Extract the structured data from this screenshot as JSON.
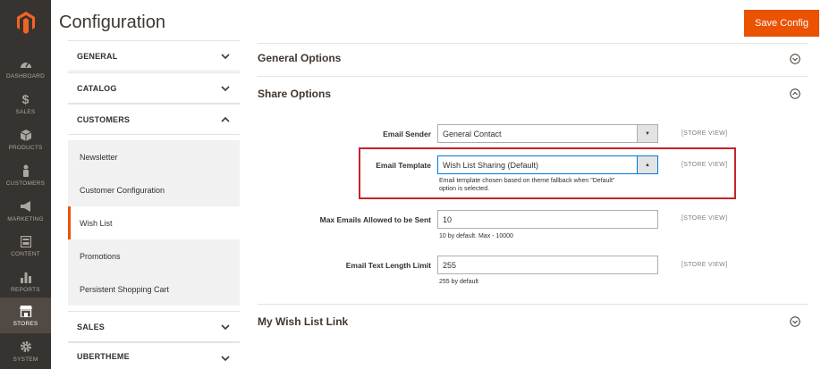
{
  "header": {
    "title": "Configuration",
    "save_label": "Save Config"
  },
  "admin_nav": [
    {
      "label": "DASHBOARD",
      "icon": "dashboard-icon"
    },
    {
      "label": "SALES",
      "icon": "dollar-icon"
    },
    {
      "label": "PRODUCTS",
      "icon": "cube-icon"
    },
    {
      "label": "CUSTOMERS",
      "icon": "person-icon"
    },
    {
      "label": "MARKETING",
      "icon": "megaphone-icon"
    },
    {
      "label": "CONTENT",
      "icon": "content-icon"
    },
    {
      "label": "REPORTS",
      "icon": "bar-chart-icon"
    },
    {
      "label": "STORES",
      "icon": "store-icon",
      "active": true
    },
    {
      "label": "SYSTEM",
      "icon": "gear-icon"
    }
  ],
  "tabs": {
    "general": "GENERAL",
    "catalog": "CATALOG",
    "customers": "CUSTOMERS",
    "items": [
      "Newsletter",
      "Customer Configuration",
      "Wish List",
      "Promotions",
      "Persistent Shopping Cart"
    ],
    "sales": "SALES",
    "ubertheme": "UBERTHEME"
  },
  "sections": {
    "general_options": "General Options",
    "share_options": "Share Options",
    "wish_list_link": "My Wish List Link"
  },
  "fields": {
    "email_sender": {
      "label": "Email Sender",
      "value": "General Contact",
      "scope": "[STORE VIEW]"
    },
    "email_template": {
      "label": "Email Template",
      "value": "Wish List Sharing (Default)",
      "note_line1": "Email template chosen based on theme fallback when \"Default\"",
      "note_line2": "option is selected.",
      "scope": "[STORE VIEW]"
    },
    "max_emails": {
      "label": "Max Emails Allowed to be Sent",
      "value": "10",
      "note": "10 by default. Max - 10000",
      "scope": "[STORE VIEW]"
    },
    "text_length": {
      "label": "Email Text Length Limit",
      "value": "255",
      "note": "255 by default",
      "scope": "[STORE VIEW]"
    }
  },
  "colors": {
    "accent": "#eb5202",
    "sidebar": "#373330",
    "highlight": "#c5232c"
  }
}
